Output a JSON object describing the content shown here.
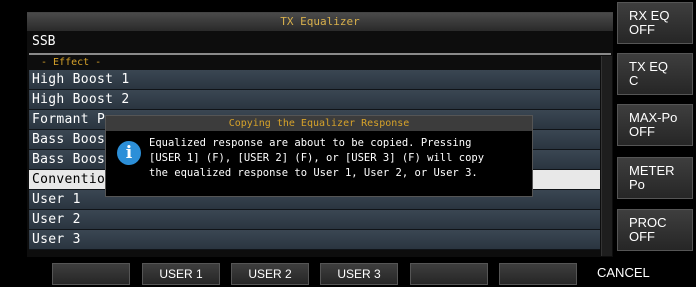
{
  "panel": {
    "title": "TX Equalizer",
    "mode": "SSB",
    "section_label": "- Effect -",
    "items": [
      {
        "label": "High Boost 1",
        "selected": false
      },
      {
        "label": "High Boost 2",
        "selected": false
      },
      {
        "label": "Formant Pass",
        "selected": false
      },
      {
        "label": "Bass Boost 1",
        "selected": false
      },
      {
        "label": "Bass Boost 2",
        "selected": false
      },
      {
        "label": "Conventional",
        "selected": true
      },
      {
        "label": "User 1",
        "selected": false
      },
      {
        "label": "User 2",
        "selected": false
      },
      {
        "label": "User 3",
        "selected": false
      }
    ]
  },
  "dialog": {
    "title": "Copying the Equalizer Response",
    "icon": "info-icon",
    "message": "Equalized response are about to be copied. Pressing\n[USER 1] (F), [USER 2] (F), or [USER 3] (F) will copy\nthe equalized response to User 1, User 2, or User 3."
  },
  "side_keys": [
    {
      "label": "RX EQ\nOFF"
    },
    {
      "label": "TX EQ\nC"
    },
    {
      "label": "MAX-Po\nOFF"
    },
    {
      "label": "METER\nPo"
    },
    {
      "label": "PROC\nOFF"
    }
  ],
  "soft_keys": [
    "",
    "USER 1",
    "USER 2",
    "USER 3",
    "",
    "",
    "CANCEL"
  ],
  "colors": {
    "title_text": "#d8b04c",
    "section_text": "#d6a22a",
    "row_bg": "#2e3a46",
    "selected_bg": "#e8e8e8",
    "info_icon": "#2c8fd8"
  }
}
